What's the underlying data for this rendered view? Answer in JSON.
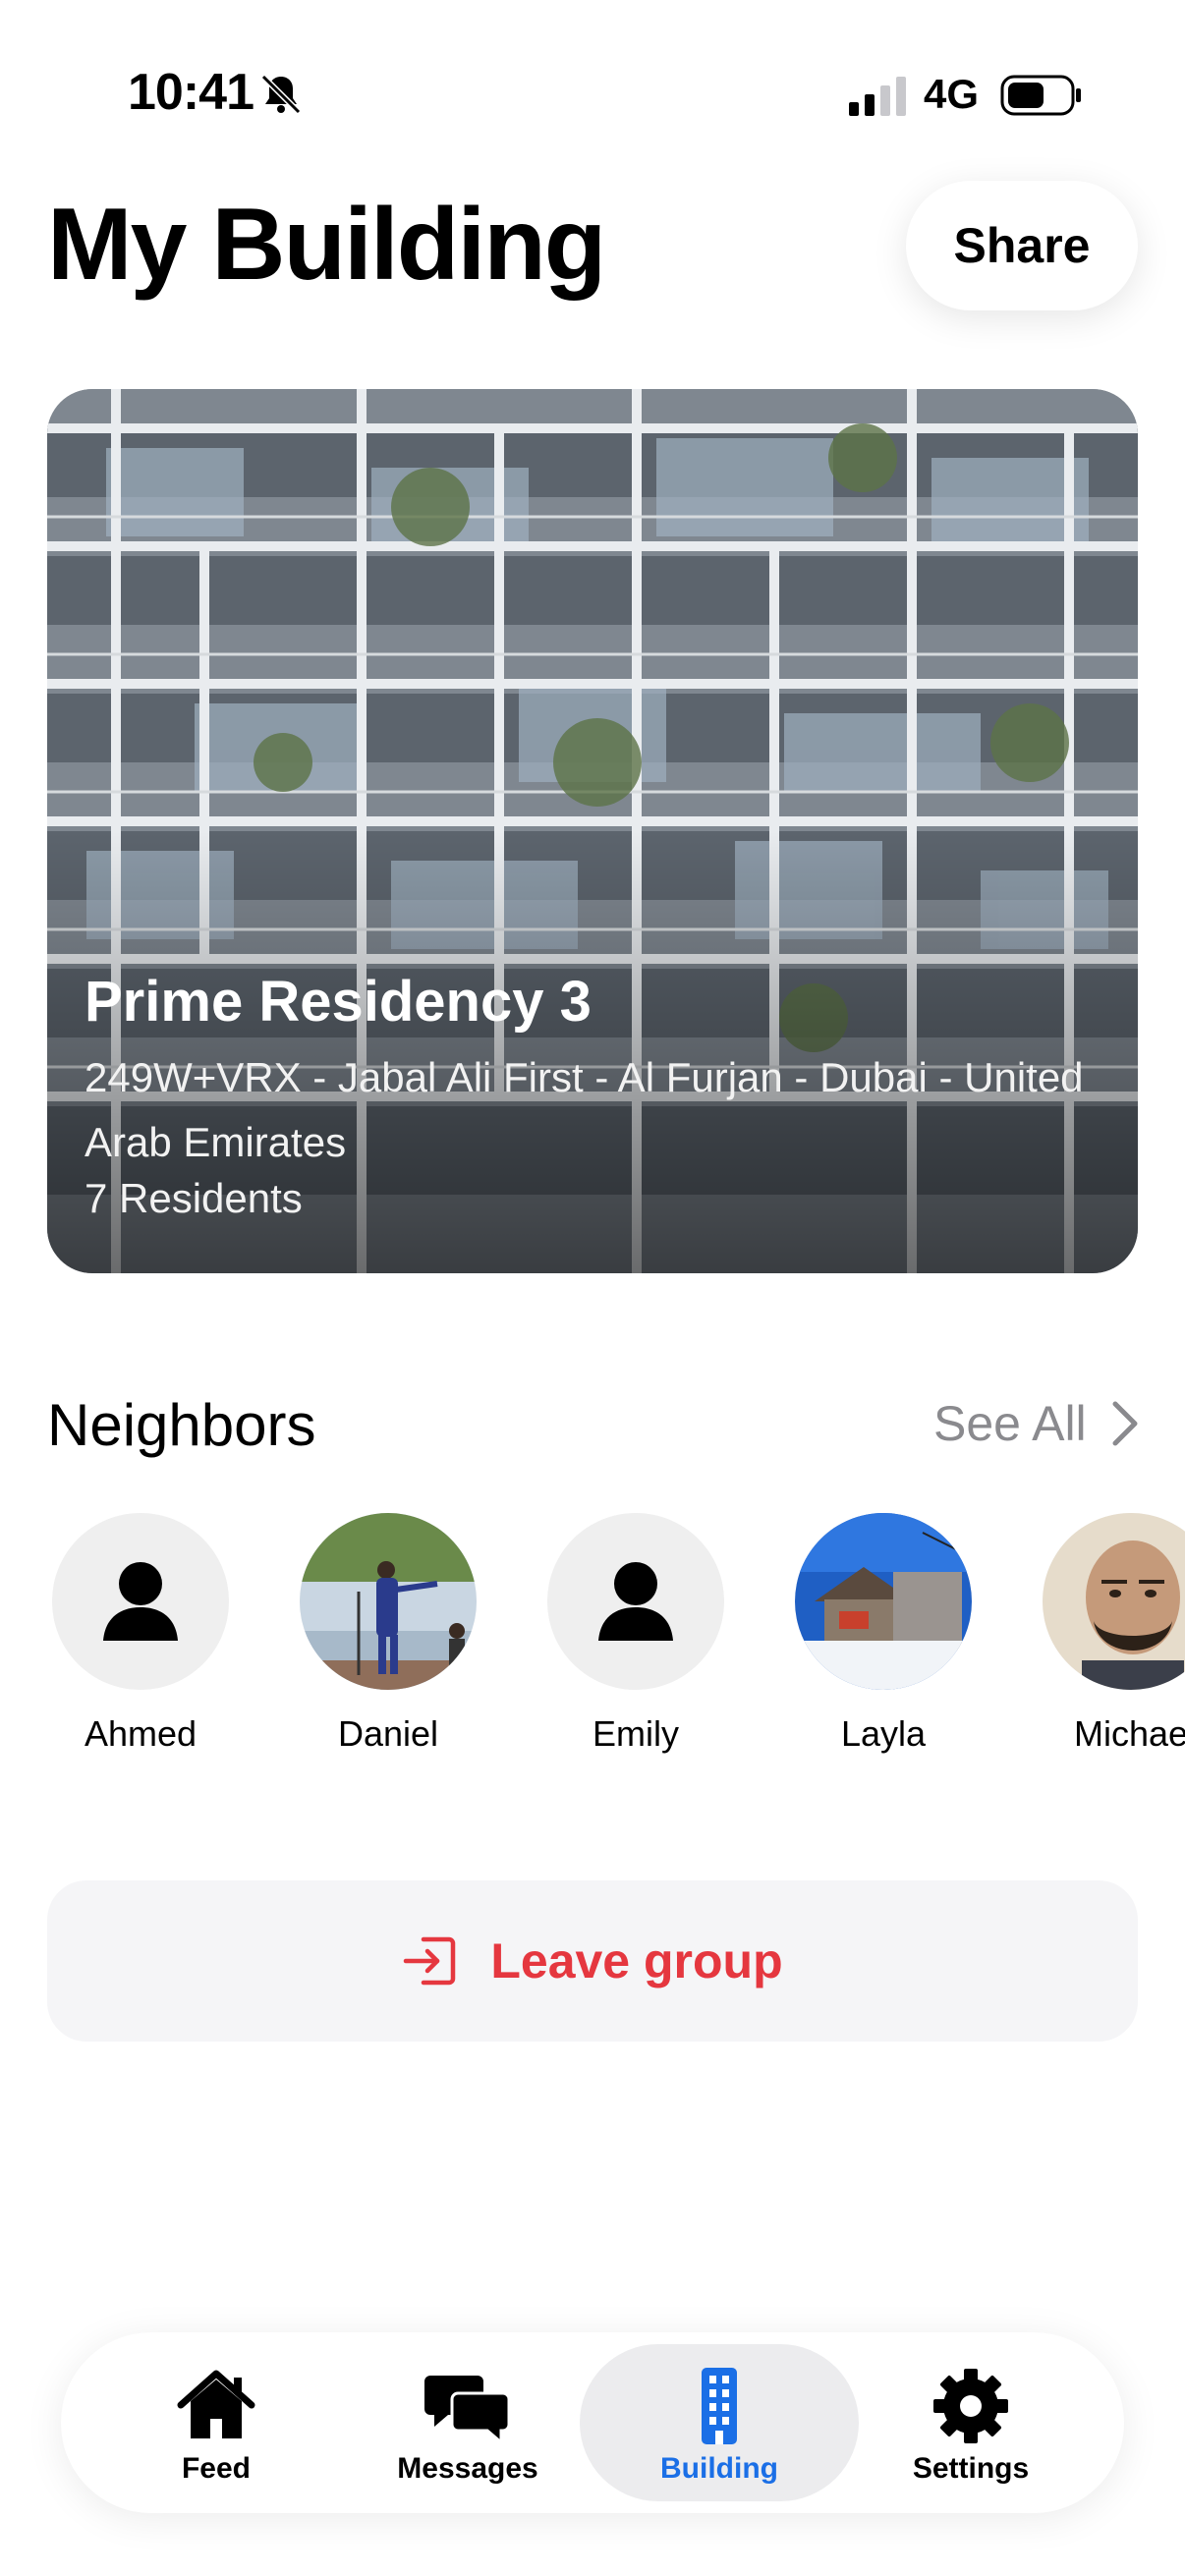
{
  "status_bar": {
    "time": "10:41",
    "network": "4G",
    "icons": [
      "bell-slash-icon",
      "signal-icon",
      "battery-icon"
    ]
  },
  "header": {
    "title": "My Building",
    "share_label": "Share"
  },
  "building": {
    "name": "Prime Residency 3",
    "address": "249W+VRX - Jabal Ali First - Al Furjan - Dubai - United Arab Emirates",
    "residents": "7 Residents"
  },
  "neighbors": {
    "title": "Neighbors",
    "see_all": "See All",
    "items": [
      {
        "name": "Ahmed",
        "avatar": "placeholder-person-icon"
      },
      {
        "name": "Daniel",
        "avatar": "photo"
      },
      {
        "name": "Emily",
        "avatar": "placeholder-person-icon"
      },
      {
        "name": "Layla",
        "avatar": "photo"
      },
      {
        "name": "Michae",
        "avatar": "photo"
      }
    ]
  },
  "leave": {
    "label": "Leave group",
    "icon": "leave-icon"
  },
  "tab_bar": {
    "tabs": [
      {
        "label": "Feed",
        "icon": "house-icon"
      },
      {
        "label": "Messages",
        "icon": "chat-bubbles-icon"
      },
      {
        "label": "Building",
        "icon": "building-icon",
        "active": true
      },
      {
        "label": "Settings",
        "icon": "gear-icon"
      }
    ]
  },
  "colors": {
    "accent_blue": "#1b6fe6",
    "danger_red": "#e5373f",
    "secondary_gray": "#8a8a8e"
  }
}
